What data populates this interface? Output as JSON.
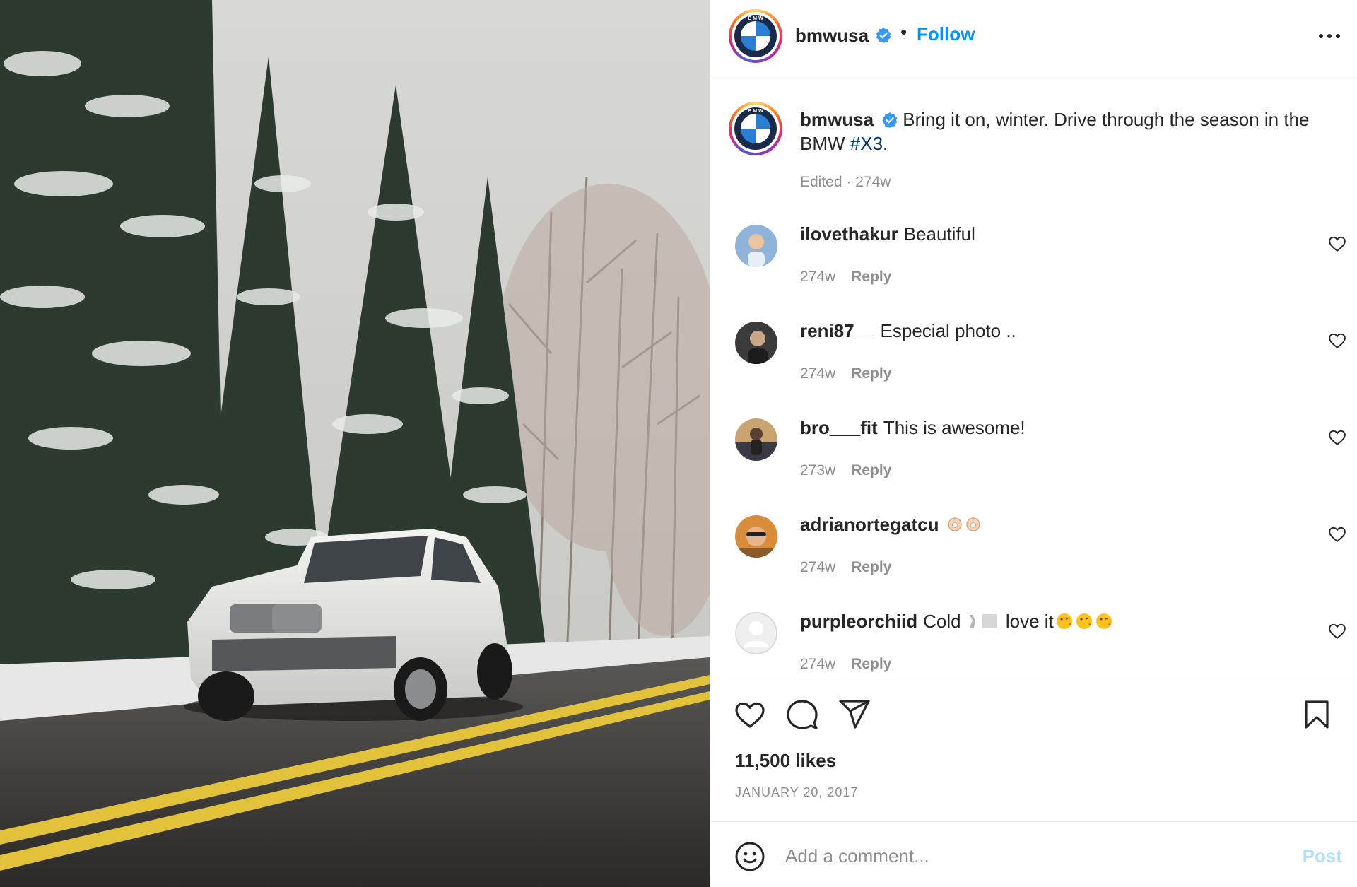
{
  "post": {
    "author": "bmwusa",
    "follow_label": "Follow",
    "separator": "•",
    "caption_prefix": "Bring it on, winter. Drive through the season in the BMW ",
    "caption_hashtag": "#X3",
    "caption_suffix": ".",
    "caption_meta": "Edited · 274w",
    "likes": "11,500 likes",
    "date": "JANUARY 20, 2017"
  },
  "comments": [
    {
      "user": "ilovethakur",
      "text": "Beautiful",
      "age": "274w",
      "reply": "Reply",
      "avatar_color": "#8fb3d9"
    },
    {
      "user": "reni87__",
      "text": "Especial photo ..",
      "age": "274w",
      "reply": "Reply",
      "avatar_color": "#3b3b3b"
    },
    {
      "user": "bro___fit",
      "text": "This is awesome!",
      "age": "273w",
      "reply": "Reply",
      "avatar_color": "#b07a3a"
    },
    {
      "user": "adrianortegatcu",
      "text": "",
      "age": "274w",
      "reply": "Reply",
      "avatar_color": "#d98c3a"
    },
    {
      "user": "purpleorchiid",
      "text": "Cold",
      "text2": "love it",
      "age": "274w",
      "reply": "Reply",
      "avatar_color": "#dbdbdb"
    }
  ],
  "add_comment": {
    "placeholder": "Add a comment...",
    "post_label": "Post"
  },
  "icons": [
    "more-options-icon",
    "verified-badge-icon",
    "heart-icon",
    "comment-icon",
    "share-icon",
    "bookmark-icon",
    "emoji-icon"
  ],
  "colors": {
    "accent": "#0095f6",
    "hashtag": "#00376b",
    "muted": "#8e8e8e",
    "verified": "#3897f0"
  }
}
